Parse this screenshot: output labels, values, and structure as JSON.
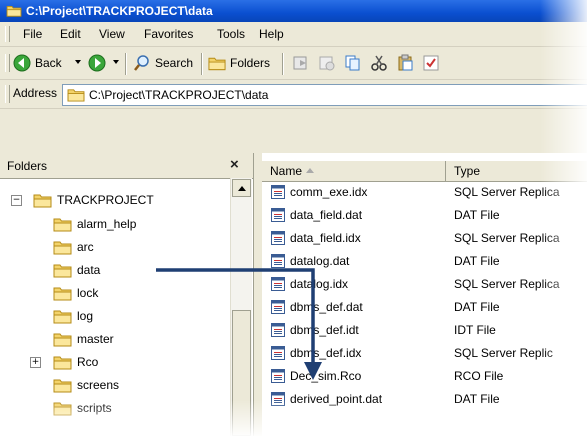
{
  "window": {
    "title": "C:\\Project\\TRACKPROJECT\\data"
  },
  "menu": [
    "File",
    "Edit",
    "View",
    "Favorites",
    "Tools",
    "Help"
  ],
  "toolbar": {
    "back_label": "Back",
    "search_label": "Search",
    "folders_label": "Folders"
  },
  "address": {
    "label": "Address",
    "value": "C:\\Project\\TRACKPROJECT\\data"
  },
  "folders": {
    "title": "Folders",
    "close": "×",
    "root": "TRACKPROJECT",
    "root_expander": "−",
    "rco_expander": "+",
    "items": [
      "alarm_help",
      "arc",
      "data",
      "lock",
      "log",
      "master",
      "Rco",
      "screens",
      "scripts"
    ]
  },
  "list": {
    "columns": {
      "name": "Name",
      "type": "Type"
    },
    "rows": [
      {
        "name": "comm_exe.idx",
        "type": "SQL Server Replica"
      },
      {
        "name": "data_field.dat",
        "type": "DAT File"
      },
      {
        "name": "data_field.idx",
        "type": "SQL Server Replica"
      },
      {
        "name": "datalog.dat",
        "type": "DAT File"
      },
      {
        "name": "datalog.idx",
        "type": "SQL Server Replica"
      },
      {
        "name": "dbms_def.dat",
        "type": "DAT File"
      },
      {
        "name": "dbms_def.idt",
        "type": "IDT File"
      },
      {
        "name": "dbms_def.idx",
        "type": "SQL Server Replic"
      },
      {
        "name": "Dec_sim.Rco",
        "type": "RCO File"
      },
      {
        "name": "derived_point.dat",
        "type": "DAT File"
      }
    ]
  },
  "colors": {
    "annotation_arrow": "#1f3f73",
    "title_bar": "#0a4fd0",
    "chrome": "#ECE9D8"
  }
}
